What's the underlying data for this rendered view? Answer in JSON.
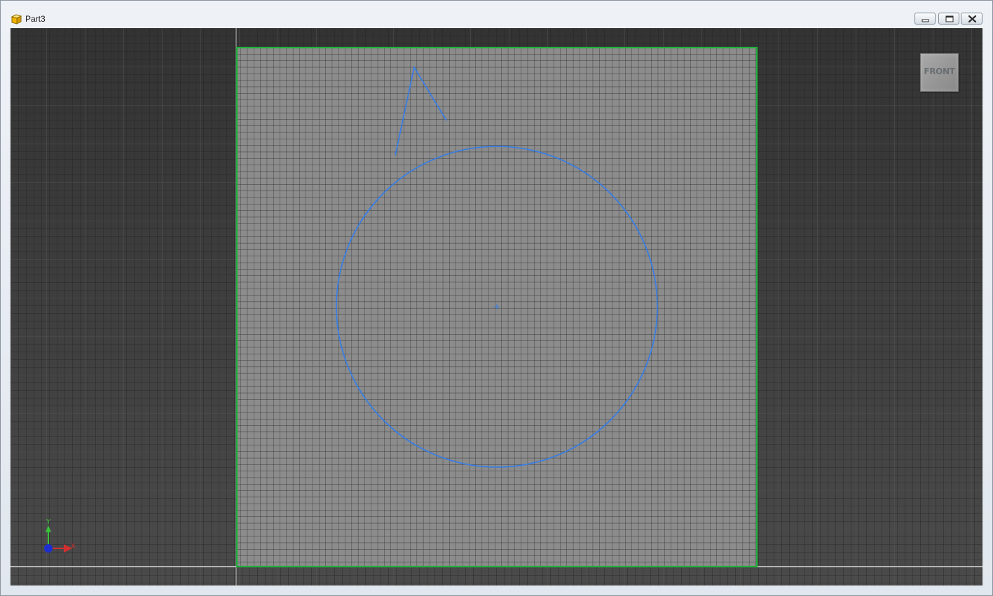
{
  "window": {
    "title": "Part3",
    "icon": "part-cube-icon",
    "controls": {
      "minimize": "minimize-icon",
      "maximize": "maximize-icon",
      "close": "close-icon"
    }
  },
  "viewport": {
    "view_cube_label": "FRONT",
    "axes": {
      "x_label": "X",
      "y_label": "Y"
    }
  },
  "colors": {
    "background_dark": "#3a3a3a",
    "grid_dark": "#2a2a2a",
    "sheet_fill": "#8c8c8c",
    "sheet_border": "#1fb13a",
    "sketch_curve": "#3a7de0",
    "axis_x": "#d03030",
    "axis_y": "#39c23c",
    "axis_origin": "#1d2fd0"
  }
}
